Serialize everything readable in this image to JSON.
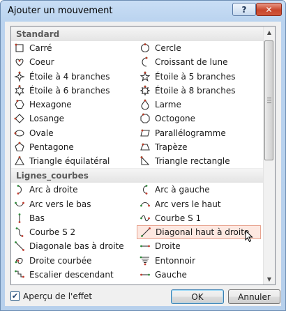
{
  "window": {
    "title": "Ajouter un mouvement",
    "help_glyph": "?",
    "close_glyph": "✕"
  },
  "groups": [
    {
      "label": "Standard",
      "items": [
        {
          "label": "Carré",
          "icon": "square-path-icon"
        },
        {
          "label": "Cercle",
          "icon": "circle-path-icon"
        },
        {
          "label": "Coeur",
          "icon": "heart-path-icon"
        },
        {
          "label": "Croissant de lune",
          "icon": "crescent-moon-path-icon"
        },
        {
          "label": "Étoile à 4 branches",
          "icon": "star4-path-icon"
        },
        {
          "label": "Étoile à 5 branches",
          "icon": "star5-path-icon"
        },
        {
          "label": "Étoile à 6 branches",
          "icon": "star6-path-icon"
        },
        {
          "label": "Étoile à 8 branches",
          "icon": "star8-path-icon"
        },
        {
          "label": "Hexagone",
          "icon": "hexagon-path-icon"
        },
        {
          "label": "Larme",
          "icon": "teardrop-path-icon"
        },
        {
          "label": "Losange",
          "icon": "diamond-path-icon"
        },
        {
          "label": "Octogone",
          "icon": "octagon-path-icon"
        },
        {
          "label": "Ovale",
          "icon": "oval-path-icon"
        },
        {
          "label": "Parallélogramme",
          "icon": "parallelogram-path-icon"
        },
        {
          "label": "Pentagone",
          "icon": "pentagon-path-icon"
        },
        {
          "label": "Trapèze",
          "icon": "trapezoid-path-icon"
        },
        {
          "label": "Triangle équilatéral",
          "icon": "equilateral-triangle-path-icon"
        },
        {
          "label": "Triangle rectangle",
          "icon": "right-triangle-path-icon"
        }
      ]
    },
    {
      "label": "Lignes_courbes",
      "items": [
        {
          "label": "Arc à droite",
          "icon": "arc-right-path-icon"
        },
        {
          "label": "Arc à gauche",
          "icon": "arc-left-path-icon"
        },
        {
          "label": "Arc vers le bas",
          "icon": "arc-down-path-icon"
        },
        {
          "label": "Arc vers le haut",
          "icon": "arc-up-path-icon"
        },
        {
          "label": "Bas",
          "icon": "down-path-icon"
        },
        {
          "label": "Courbe S 1",
          "icon": "s-curve1-path-icon"
        },
        {
          "label": "Courbe S 2",
          "icon": "s-curve2-path-icon"
        },
        {
          "label": "Diagonal haut à droite",
          "icon": "diagonal-up-right-path-icon",
          "selected": true
        },
        {
          "label": "Diagonale bas à droite",
          "icon": "diagonal-down-right-path-icon"
        },
        {
          "label": "Droite",
          "icon": "right-path-icon"
        },
        {
          "label": "Droite courbée",
          "icon": "curvy-right-path-icon"
        },
        {
          "label": "Entonnoir",
          "icon": "funnel-path-icon"
        },
        {
          "label": "Escalier descendant",
          "icon": "stairs-down-path-icon"
        },
        {
          "label": "Gauche",
          "icon": "left-path-icon"
        }
      ]
    }
  ],
  "footer": {
    "preview_label": "Aperçu de l'effet",
    "preview_checked": true,
    "ok_label": "OK",
    "cancel_label": "Annuler"
  },
  "colors": {
    "icon_green": "#2e8b3a",
    "icon_red": "#c0392b",
    "selection_bg": "#fde8e1"
  }
}
